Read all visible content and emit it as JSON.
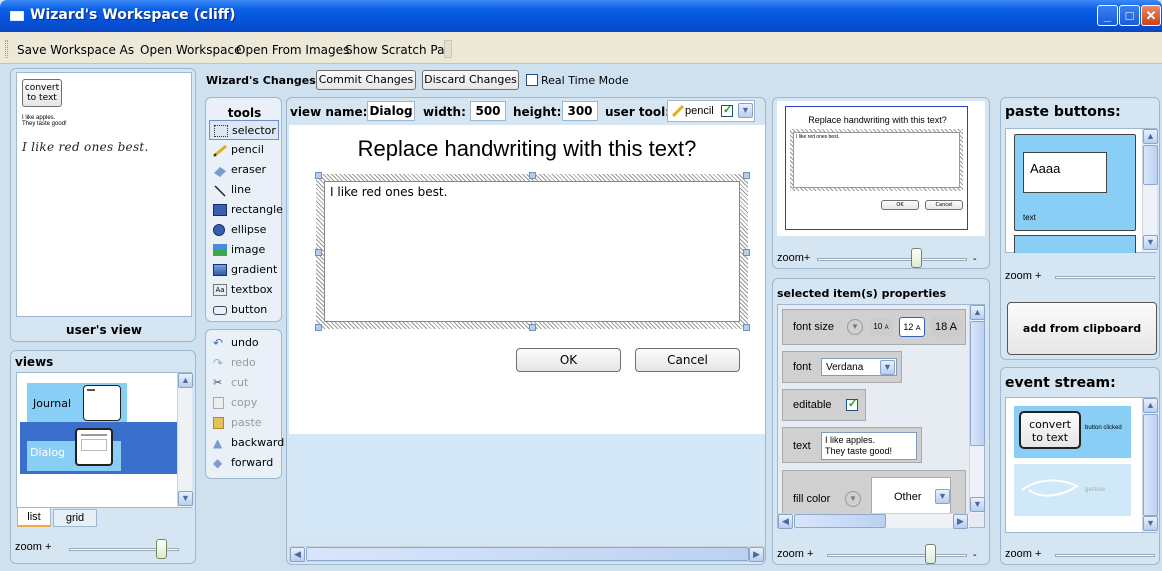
{
  "window": {
    "title": "Wizard's Workspace (cliff)"
  },
  "menu": {
    "items": [
      "Save Workspace As",
      "Open Workspace",
      "Open From Images",
      "Show Scratch Pad"
    ]
  },
  "users_view": {
    "convert_button": "convert\nto text",
    "small_text_line1": "I like apples.",
    "small_text_line2": "They taste good!",
    "handwriting": "I like red ones best.",
    "label": "user's view"
  },
  "views": {
    "title": "views",
    "items": [
      {
        "label": "Journal",
        "selected": false
      },
      {
        "label": "Dialog",
        "selected": true
      }
    ],
    "tabs": [
      "list",
      "grid"
    ],
    "zoom_label": "zoom +",
    "zoom_level": 0.85
  },
  "wizard_changes": {
    "label": "Wizard's Changes:",
    "commit": "Commit Changes",
    "discard": "Discard Changes",
    "realtime_label": "Real Time Mode",
    "realtime_checked": false
  },
  "tools": {
    "title": "tools",
    "items": [
      {
        "label": "selector",
        "icon": "selector-icon",
        "selected": true
      },
      {
        "label": "pencil",
        "icon": "pencil-icon"
      },
      {
        "label": "eraser",
        "icon": "eraser-icon"
      },
      {
        "label": "line",
        "icon": "line-icon"
      },
      {
        "label": "rectangle",
        "icon": "rectangle-icon"
      },
      {
        "label": "ellipse",
        "icon": "ellipse-icon"
      },
      {
        "label": "image",
        "icon": "image-icon"
      },
      {
        "label": "gradient",
        "icon": "gradient-icon"
      },
      {
        "label": "textbox",
        "icon": "textbox-icon",
        "icon_text": "Aa"
      },
      {
        "label": "button",
        "icon": "button-icon"
      }
    ],
    "actions": [
      {
        "label": "undo",
        "enabled": true,
        "icon": "undo-icon"
      },
      {
        "label": "redo",
        "enabled": false,
        "icon": "redo-icon"
      },
      {
        "label": "cut",
        "enabled": false,
        "icon": "cut-icon"
      },
      {
        "label": "copy",
        "enabled": false,
        "icon": "copy-icon"
      },
      {
        "label": "paste",
        "enabled": false,
        "icon": "paste-icon"
      },
      {
        "label": "backward",
        "enabled": true,
        "icon": "backward-icon"
      },
      {
        "label": "forward",
        "enabled": true,
        "icon": "forward-icon"
      }
    ]
  },
  "canvas_bar": {
    "view_name_label": "view name:",
    "view_name": "Dialog",
    "width_label": "width:",
    "width": "500",
    "height_label": "height:",
    "height": "300",
    "user_tool_label": "user tool:",
    "user_tool": "pencil",
    "user_tool_checked": true
  },
  "canvas": {
    "heading": "Replace handwriting with this text?",
    "textbox_text": "I like red ones best.",
    "ok": "OK",
    "cancel": "Cancel"
  },
  "preview": {
    "heading": "Replace handwriting with this text?",
    "text": "I like red ones best.",
    "ok": "OK",
    "cancel": "Cancel",
    "zoom_label": "zoom+",
    "zoom_end": "-",
    "zoom_level": 0.72
  },
  "properties": {
    "title": "selected item(s) properties",
    "font_size_label": "font size",
    "font_sizes": [
      "10",
      "12",
      "18"
    ],
    "font_size_unit": "A",
    "selected_font_size": "12",
    "font_label": "font",
    "font_value": "Verdana",
    "editable_label": "editable",
    "editable_checked": true,
    "text_label": "text",
    "text_line1": "I like apples.",
    "text_line2": "They taste good!",
    "fill_label": "fill color",
    "fill_value": "Other",
    "zoom_label": "zoom +",
    "zoom_end": "-",
    "zoom_level": 0.75
  },
  "paste_buttons": {
    "title": "paste buttons:",
    "card_text": "Aaaa",
    "card_caption": "text",
    "add_label": "add from clipboard",
    "zoom_label": "zoom +"
  },
  "event_stream": {
    "title": "event stream:",
    "items": [
      {
        "button_text": "convert\nto text",
        "caption": "button clicked"
      },
      {
        "caption": "gesture"
      }
    ],
    "zoom_label": "zoom +"
  },
  "colors": {
    "titlebar": "#0a5fe4",
    "panel": "#d6e5f2",
    "selected": "#3a6fcb",
    "card": "#89cff5"
  }
}
